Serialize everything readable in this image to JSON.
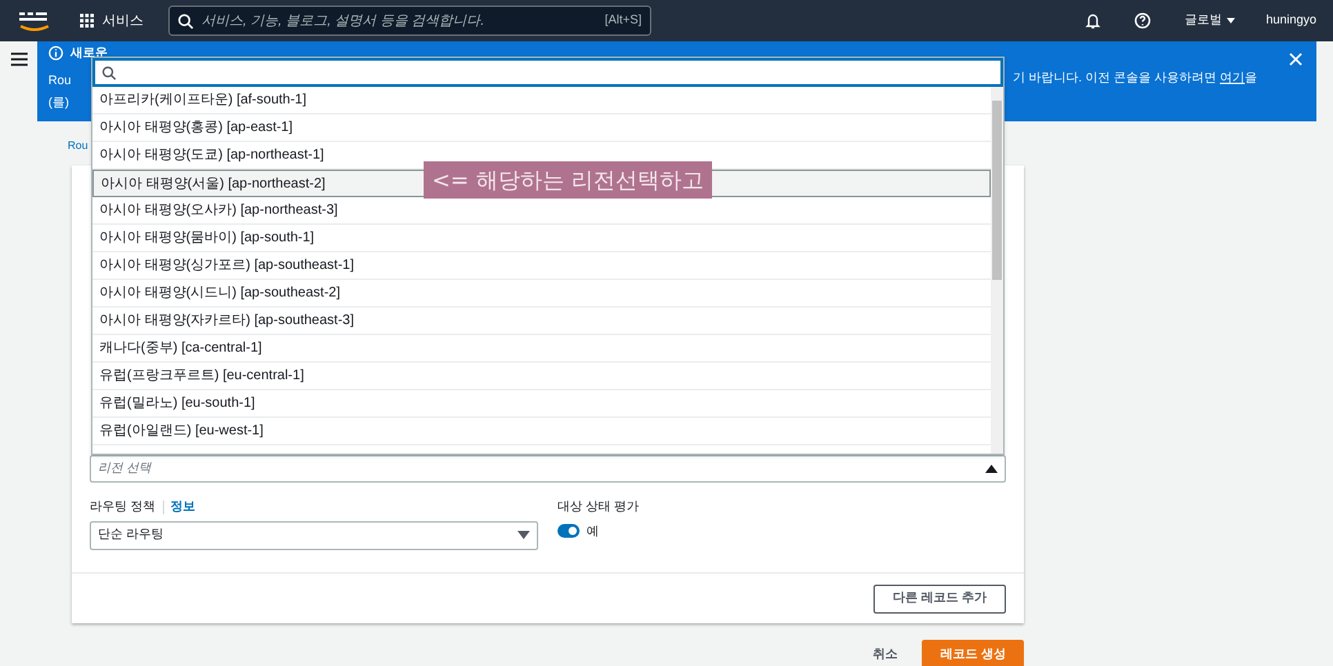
{
  "top_nav": {
    "services_label": "서비스",
    "search": {
      "placeholder": "서비스, 기능, 블로그, 설명서 등을 검색합니다.",
      "shortcut": "[Alt+S]"
    },
    "region_menu": "글로벌",
    "user_menu": "huningyo"
  },
  "banner": {
    "title": "새로운",
    "line_1": "Rou",
    "line_2": "(를)",
    "right_text": "기 바랍니다. 이전 콘솔을 사용하려면 ",
    "link": "여기",
    "right_suffix": "을"
  },
  "breadcrumb": "Rou",
  "region_dropdown": {
    "options": [
      {
        "label": "아프리카(케이프타운) [af-south-1]",
        "selected": false
      },
      {
        "label": "아시아 태평양(홍콩) [ap-east-1]",
        "selected": false
      },
      {
        "label": "아시아 태평양(도쿄) [ap-northeast-1]",
        "selected": false
      },
      {
        "label": "아시아 태평양(서울) [ap-northeast-2]",
        "selected": true
      },
      {
        "label": "아시아 태평양(오사카) [ap-northeast-3]",
        "selected": false
      },
      {
        "label": "아시아 태평양(뭄바이) [ap-south-1]",
        "selected": false
      },
      {
        "label": "아시아 태평양(싱가포르) [ap-southeast-1]",
        "selected": false
      },
      {
        "label": "아시아 태평양(시드니) [ap-southeast-2]",
        "selected": false
      },
      {
        "label": "아시아 태평양(자카르타) [ap-southeast-3]",
        "selected": false
      },
      {
        "label": "캐나다(중부) [ca-central-1]",
        "selected": false
      },
      {
        "label": "유럽(프랑크푸르트) [eu-central-1]",
        "selected": false
      },
      {
        "label": "유럽(밀라노) [eu-south-1]",
        "selected": false
      },
      {
        "label": "유럽(아일랜드) [eu-west-1]",
        "selected": false
      }
    ],
    "placeholder": "리전 선택"
  },
  "annotation": "<= 해당하는 리전선택하고",
  "routing_policy": {
    "label": "라우팅 정책",
    "info_link": "정보",
    "value": "단순 라우팅"
  },
  "health_check": {
    "label": "대상 상태 평가",
    "on": true,
    "value_label": "예"
  },
  "add_record_button": "다른 레코드 추가",
  "footer": {
    "cancel": "취소",
    "create": "레코드 생성"
  }
}
